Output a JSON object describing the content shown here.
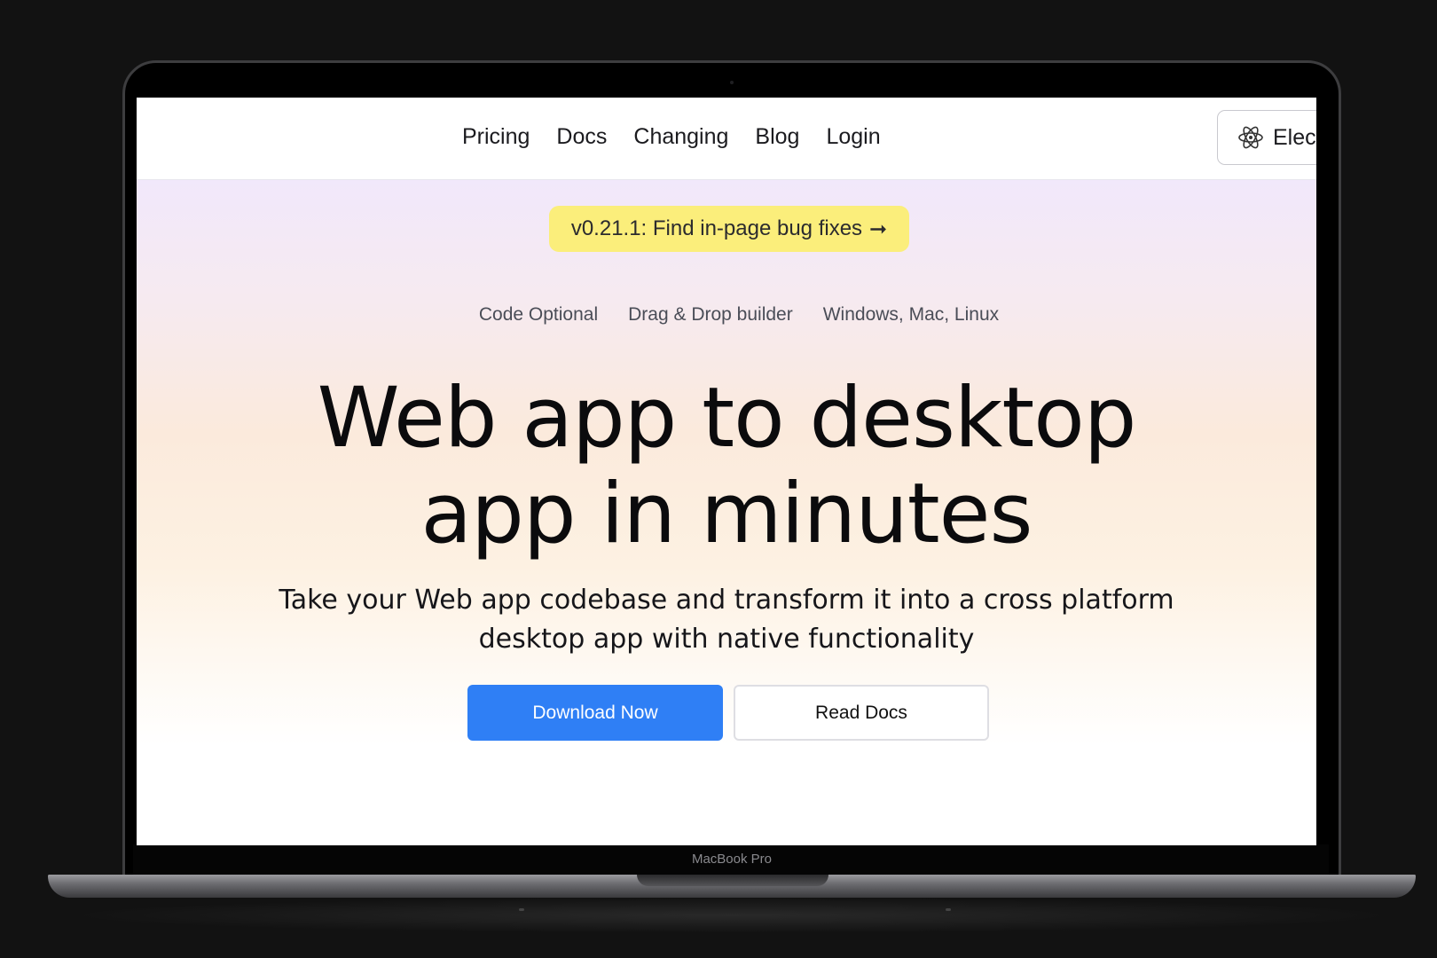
{
  "device": {
    "model_label": "MacBook Pro"
  },
  "nav": {
    "links": [
      "Pricing",
      "Docs",
      "Changing",
      "Blog",
      "Login"
    ],
    "action_button": {
      "icon": "electron-icon",
      "label": "Elec"
    }
  },
  "announcement": {
    "text": "v0.21.1: Find in-page bug fixes",
    "arrow": "➞",
    "background": "#fbee7b"
  },
  "features": [
    "Code Optional",
    "Drag & Drop builder",
    "Windows, Mac, Linux"
  ],
  "hero": {
    "headline_line1": "Web app to desktop",
    "headline_line2": "app in minutes",
    "subtitle_line1": "Take your Web app codebase and transform it into a cross platform",
    "subtitle_line2": "desktop app with native functionality"
  },
  "actions": {
    "primary": {
      "label": "Download Now",
      "color": "#2f7ff5"
    },
    "secondary": {
      "label": "Read Docs"
    }
  }
}
